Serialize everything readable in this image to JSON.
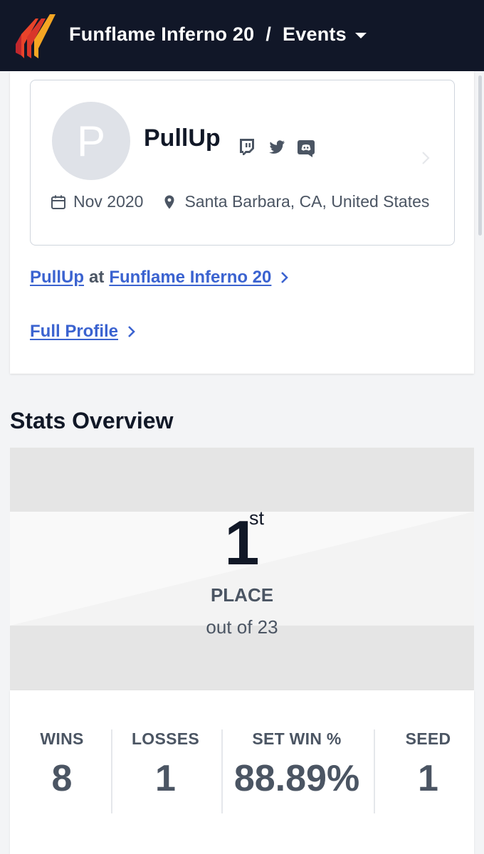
{
  "header": {
    "tournament": "Funflame Inferno 20",
    "separator": "/",
    "section": "Events",
    "colors": {
      "bar": "#111728",
      "logo_primary": "#e8432a",
      "logo_secondary": "#f5a623"
    }
  },
  "player": {
    "avatar_initial": "P",
    "name": "PullUp",
    "socials": [
      "twitch-icon",
      "twitter-icon",
      "discord-icon"
    ],
    "joined": "Nov 2020",
    "location": "Santa Barbara, CA, United States"
  },
  "links": {
    "player_at_event": {
      "player": "PullUp",
      "connector": "at",
      "event": "Funflame Inferno 20"
    },
    "full_profile": "Full Profile",
    "link_color": "#3b63d0"
  },
  "stats": {
    "heading": "Stats Overview",
    "placement": {
      "number": "1",
      "suffix": "st",
      "label": "PLACE",
      "out_of": "out of 23"
    },
    "items": [
      {
        "label": "WINS",
        "value": "8"
      },
      {
        "label": "LOSSES",
        "value": "1"
      },
      {
        "label": "SET WIN %",
        "value": "88.89%"
      },
      {
        "label": "SEED",
        "value": "1"
      }
    ]
  }
}
